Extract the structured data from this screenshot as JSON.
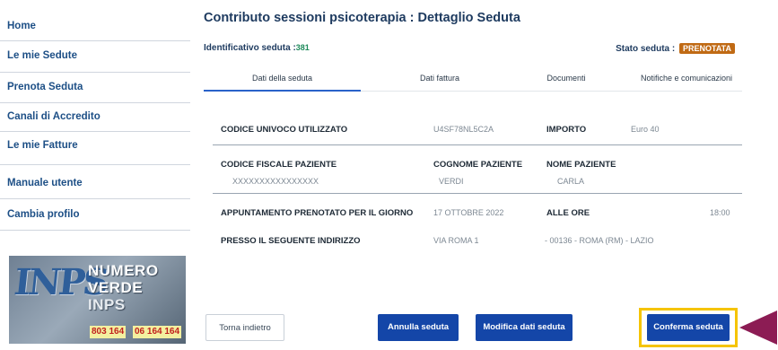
{
  "sidebar": {
    "items": [
      {
        "label": "Home"
      },
      {
        "label": "Le mie Sedute"
      },
      {
        "label": "Prenota Seduta"
      },
      {
        "label": "Canali di Accredito"
      },
      {
        "label": "Le mie Fatture"
      },
      {
        "label": "Manuale utente"
      },
      {
        "label": "Cambia profilo"
      }
    ]
  },
  "banner": {
    "logo": "INPS",
    "line1": "NUMERO",
    "line2": "VERDE",
    "line3": "INPS",
    "number1": "803 164",
    "number2": "06 164 164"
  },
  "page": {
    "title": "Contributo sessioni psicoterapia : Dettaglio Seduta",
    "id_label": "Identificativo seduta :",
    "id_value": "381",
    "stato_label": "Stato seduta :",
    "stato_value": "PRENOTATA"
  },
  "tabs": [
    {
      "label": "Dati della seduta",
      "active": true
    },
    {
      "label": "Dati fattura"
    },
    {
      "label": "Documenti"
    },
    {
      "label": "Notifiche e comunicazioni"
    }
  ],
  "details": {
    "codice_univoco_label": "CODICE UNIVOCO UTILIZZATO",
    "codice_univoco_value": "U4SF78NL5C2A",
    "importo_label": "IMPORTO",
    "importo_value": "Euro 40",
    "cf_label": "CODICE FISCALE PAZIENTE",
    "cf_value": "XXXXXXXXXXXXXXXX",
    "cognome_label": "COGNOME PAZIENTE",
    "cognome_value": "VERDI",
    "nome_label": "NOME PAZIENTE",
    "nome_value": "CARLA",
    "appuntamento_label": "APPUNTAMENTO PRENOTATO PER IL GIORNO",
    "appuntamento_value": "17 OTTOBRE 2022",
    "ore_label": "ALLE ORE",
    "ore_value": "18:00",
    "indirizzo_label": "PRESSO IL SEGUENTE INDIRIZZO",
    "indirizzo_value": "VIA ROMA 1",
    "indirizzo_citta": "- 00136 - ROMA (RM) - LAZIO"
  },
  "buttons": {
    "back": "Torna indietro",
    "annulla": "Annulla seduta",
    "modifica": "Modifica dati seduta",
    "conferma": "Conferma seduta"
  },
  "colors": {
    "primary": "#1446a8",
    "badge": "#c06a14",
    "highlight": "#f5c400",
    "arrow": "#8c1c54"
  }
}
